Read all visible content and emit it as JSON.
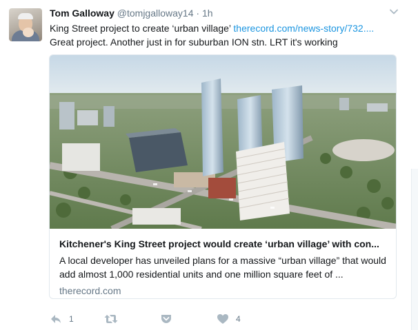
{
  "tweet": {
    "author_name": "Tom Galloway",
    "handle": "@tomjgalloway14",
    "separator": "·",
    "time": "1h",
    "text_line1": "King Street project to create ‘urban village’ ",
    "link": "therecord.com/news-story/732....",
    "text_line2": "Great project. Another just in for suburban ION stn. LRT it's working"
  },
  "card": {
    "title": "Kitchener's King Street project would create ‘urban village’ with con...",
    "description": "A local developer has unveiled plans for a massive “urban village” that would add almost 1,000 residential units and one million square feet of ...",
    "domain": "therecord.com",
    "image_icon": "city-rendering-image"
  },
  "actions": {
    "reply_count": "1",
    "retweet_count": "",
    "like_count": "4"
  },
  "colors": {
    "link": "#1b95e0",
    "secondary": "#657786",
    "icon": "#aab8c2",
    "border": "#e1e8ed"
  }
}
